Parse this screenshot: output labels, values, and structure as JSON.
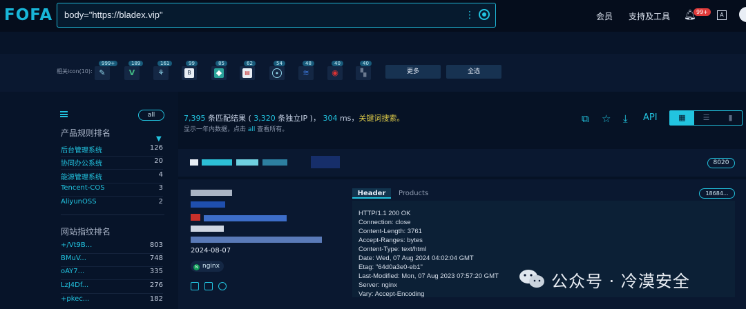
{
  "app": {
    "logo": "FOFA"
  },
  "search": {
    "query": "body=\"https://bladex.vip\""
  },
  "nav": {
    "member": "会员",
    "support": "支持及工具",
    "notifications": "99+"
  },
  "icon_row": {
    "label": "相关icon(10):",
    "counts": [
      "999+",
      "189",
      "161",
      "99",
      "85",
      "62",
      "54",
      "48",
      "40",
      "40"
    ],
    "more": "更多",
    "select_all": "全选"
  },
  "sidebar": {
    "all": "all",
    "products_title": "产品规则排名",
    "products": [
      {
        "name": "后台管理系统",
        "count": "126"
      },
      {
        "name": "协同办公系统",
        "count": "20"
      },
      {
        "name": "能源管理系统",
        "count": "4"
      },
      {
        "name": "Tencent-COS",
        "count": "3"
      },
      {
        "name": "AliyunOSS",
        "count": "2"
      }
    ],
    "fingerprint_title": "网站指纹排名",
    "fingerprints": [
      {
        "name": "+/Vt9B...",
        "count": "803"
      },
      {
        "name": "BMuV...",
        "count": "748"
      },
      {
        "name": "oAY7...",
        "count": "335"
      },
      {
        "name": "LzJ4Df...",
        "count": "276"
      },
      {
        "name": "+pkec...",
        "count": "182"
      }
    ]
  },
  "summary": {
    "results": "7,395",
    "results_label": " 条匹配结果 ( ",
    "ips": "3,320",
    "ips_label": " 条独立IP )， ",
    "ms": "304",
    "ms_label": " ms，",
    "keyword": "关键词搜索。",
    "sub_pre": "显示一年内数据，点击 ",
    "sub_all": "all",
    "sub_post": " 查看所有。",
    "api": "API"
  },
  "result": {
    "port": "8020",
    "date": "2024-08-07",
    "server_tag": "nginx",
    "tab_header": "Header",
    "tab_products": "Products",
    "count_pill": "18684...",
    "header_lines": [
      "HTTP/1.1 200 OK",
      "Connection: close",
      "Content-Length: 3761",
      "Accept-Ranges: bytes",
      "Content-Type: text/html",
      "Date: Wed, 07 Aug 2024 04:02:04 GMT",
      "Etag: \"64d0a3e0-eb1\"",
      "Last-Modified: Mon, 07 Aug 2023 07:57:20 GMT",
      "Server: nginx",
      "Vary: Accept-Encoding"
    ]
  },
  "watermark": {
    "text": "公众号 · 冷漠安全"
  },
  "colors": {
    "accent": "#22c4e0",
    "background": "#061225",
    "keyword": "#e2cf49"
  }
}
